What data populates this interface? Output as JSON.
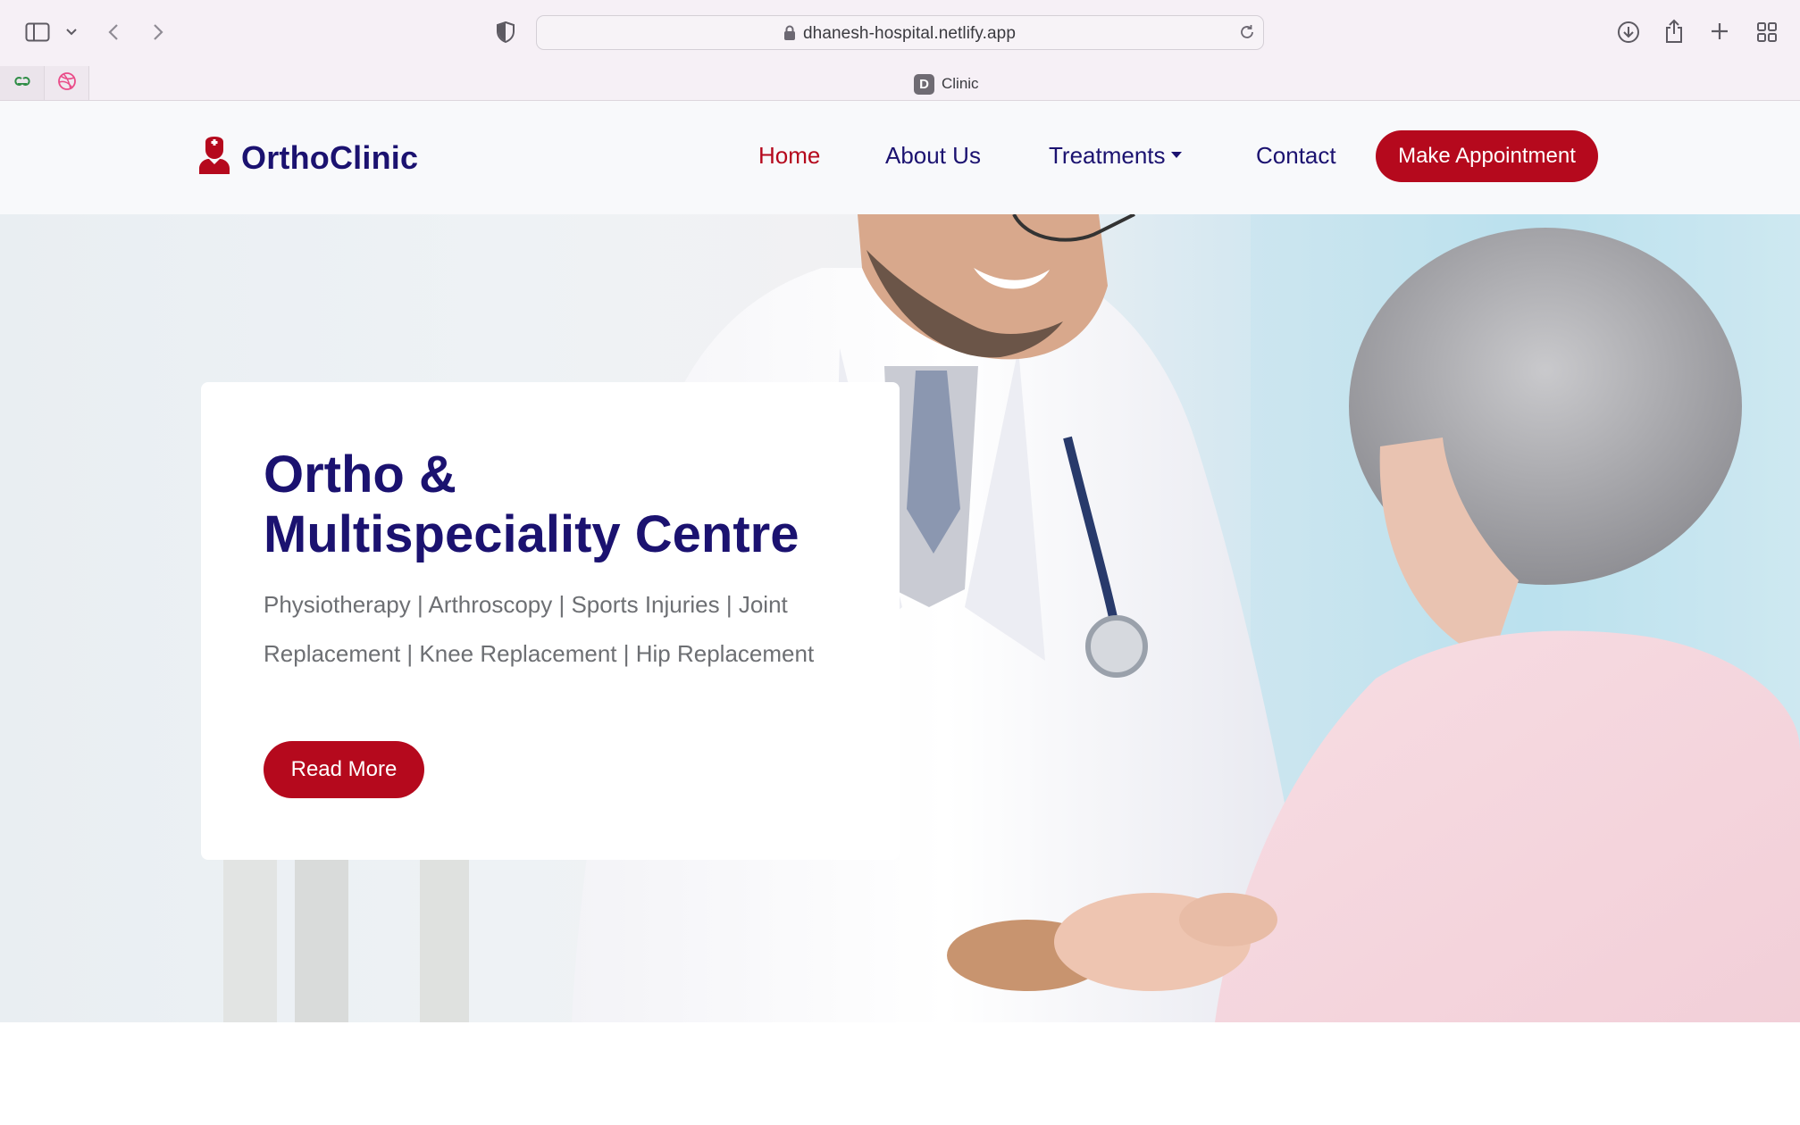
{
  "browser": {
    "url": "dhanesh-hospital.netlify.app",
    "tab_title": "Clinic",
    "tab_favicon_letter": "D",
    "icons": [
      "sidebar-icon",
      "chevron-down-icon",
      "back-icon",
      "forward-icon",
      "shield-icon",
      "lock-icon",
      "reload-icon",
      "download-icon",
      "share-icon",
      "new-tab-icon",
      "tab-overview-icon"
    ]
  },
  "site": {
    "brand": "OrthoClinic",
    "nav": {
      "home": "Home",
      "about": "About Us",
      "treatments": "Treatments",
      "contact": "Contact",
      "appointment": "Make Appointment"
    },
    "hero": {
      "title_line1": "Ortho &",
      "title_line2": "Multispeciality Centre",
      "subtitle": "Physiotherapy | Arthroscopy | Sports Injuries | Joint Replacement | Knee Replacement | Hip Replacement",
      "cta": "Read More"
    }
  },
  "colors": {
    "brand_navy": "#1b1270",
    "accent_red": "#b5091d",
    "subtitle_gray": "#6d6f73"
  }
}
